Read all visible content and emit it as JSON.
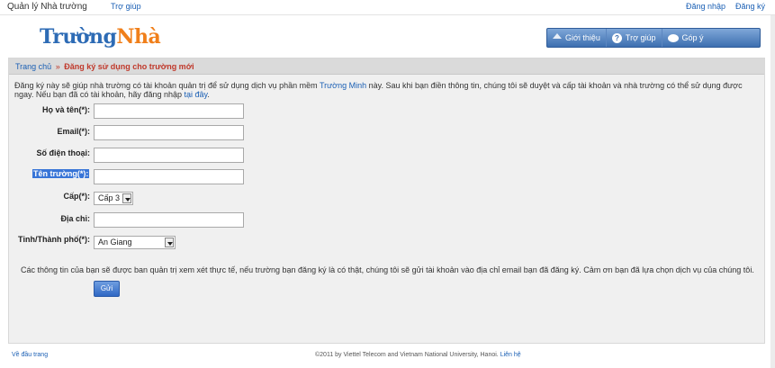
{
  "topbar": {
    "site_name": "Quản lý Nhà trường",
    "help": "Trợ giúp",
    "login": "Đăng nhập",
    "register": "Đăng ký"
  },
  "logo": {
    "part1": "Trường",
    "part2": "Nhà"
  },
  "nav": {
    "about": "Giới thiệu",
    "help": "Trợ giúp",
    "feedback": "Góp ý"
  },
  "breadcrumb": {
    "home": "Trang chủ",
    "separator": "»",
    "current": "Đăng ký sử dụng cho trường mới"
  },
  "intro": {
    "text_before": "Đăng ký này sẽ giúp nhà trường có tài khoản quản trị để sử dụng dịch vụ phần mềm ",
    "link_product": "Trường Minh",
    "text_middle": " này. Sau khi bạn điền thông tin, chúng tôi sẽ duyệt và cấp tài khoản và nhà trường có thể sử dụng được ngay. Nếu bạn đã có tài khoản, hãy đăng nhập ",
    "link_here": "tại đây",
    "text_after": "."
  },
  "form": {
    "fullname_label": "Họ và tên(*):",
    "fullname_value": "",
    "email_label": "Email(*):",
    "email_value": "",
    "phone_label": "Số điện thoại:",
    "phone_value": "",
    "school_label": "Tên trường(*):",
    "school_value": "",
    "level_label": "Cấp(*):",
    "level_value": "Cấp 3",
    "address_label": "Địa chỉ:",
    "address_value": "",
    "province_label": "Tỉnh/Thành phố(*):",
    "province_value": "An Giang",
    "note": "Các thông tin của bạn sẽ được ban quản trị xem xét thực tế, nếu trường bạn đăng ký là có thật, chúng tôi sẽ gửi tài khoản vào địa chỉ email bạn đã đăng ký. Cảm ơn bạn đã lựa chọn dịch vụ của chúng tôi.",
    "submit_label": "Gửi"
  },
  "footer": {
    "back_to_top": "Về đầu trang",
    "copyright": "©2011 by Viettel Telecom and Vietnam National University, Hanoi. ",
    "contact": "Liên hệ"
  }
}
